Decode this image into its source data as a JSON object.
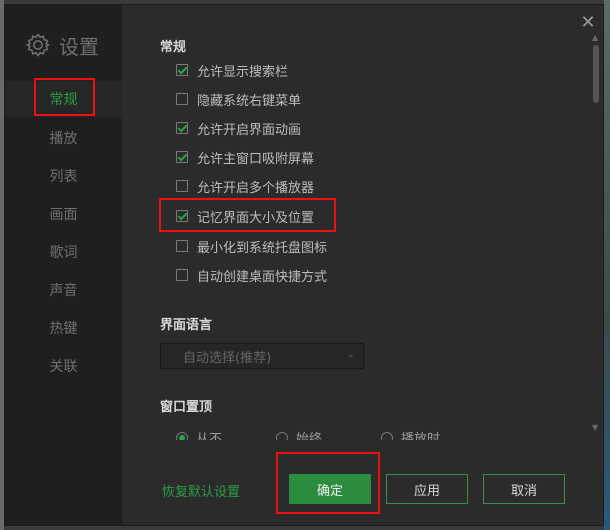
{
  "sidebar": {
    "title": "设置",
    "items": [
      {
        "label": "常规"
      },
      {
        "label": "播放"
      },
      {
        "label": "列表"
      },
      {
        "label": "画面"
      },
      {
        "label": "歌词"
      },
      {
        "label": "声音"
      },
      {
        "label": "热键"
      },
      {
        "label": "关联"
      }
    ]
  },
  "general": {
    "heading": "常规",
    "options": [
      {
        "label": "允许显示搜索栏",
        "checked": true
      },
      {
        "label": "隐藏系统右键菜单",
        "checked": false
      },
      {
        "label": "允许开启界面动画",
        "checked": true
      },
      {
        "label": "允许主窗口吸附屏幕",
        "checked": true
      },
      {
        "label": "允许开启多个播放器",
        "checked": false
      },
      {
        "label": "记忆界面大小及位置",
        "checked": true
      },
      {
        "label": "最小化到系统托盘图标",
        "checked": false
      },
      {
        "label": "自动创建桌面快捷方式",
        "checked": false
      }
    ]
  },
  "language": {
    "heading": "界面语言",
    "selected": "自动选择(推荐)"
  },
  "window_top": {
    "heading": "窗口置顶",
    "radios": [
      {
        "label": "从不",
        "selected": true
      },
      {
        "label": "始终",
        "selected": false
      },
      {
        "label": "播放时",
        "selected": false
      }
    ]
  },
  "footer": {
    "reset_label": "恢复默认设置",
    "ok_label": "确定",
    "apply_label": "应用",
    "cancel_label": "取消"
  },
  "colors": {
    "accent": "#2a9d47",
    "highlight": "#e11111",
    "background": "#2b2b2b",
    "sidebar": "#1f1f1f"
  },
  "icons": {
    "title": "gear-icon",
    "close": "close-icon",
    "dropdown": "chevron-down-icon"
  }
}
